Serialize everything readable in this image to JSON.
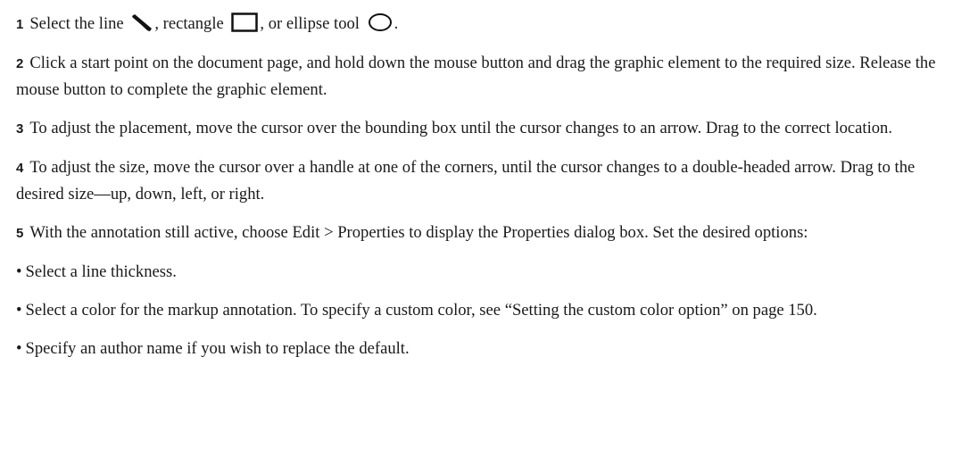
{
  "steps": [
    {
      "number": "1",
      "parts": {
        "a": "Select the line",
        "b": ", rectangle",
        "c": ", or ellipse tool",
        "d": "."
      },
      "icons": [
        "line-tool-icon",
        "rectangle-tool-icon",
        "ellipse-tool-icon"
      ]
    },
    {
      "number": "2",
      "text": "Click a start point on the document page, and hold down the mouse button and drag the graphic element to the required size. Release the mouse button to complete the graphic element."
    },
    {
      "number": "3",
      "text": "To adjust the placement, move the cursor over the bounding box until the cursor changes to an arrow. Drag to the correct location."
    },
    {
      "number": "4",
      "text": "To adjust the size, move the cursor over a handle at one of the corners, until the cursor changes to a double-headed arrow. Drag to the desired size—up, down, left, or right."
    },
    {
      "number": "5",
      "text": "With the annotation still active, choose Edit > Properties to display the Properties dialog box. Set the desired options:"
    }
  ],
  "bullets": [
    {
      "marker": "•",
      "text": "Select a line thickness."
    },
    {
      "marker": "•",
      "text": "Select a color for the markup annotation. To specify a custom color, see “Setting the custom color option” on page 150."
    },
    {
      "marker": "•",
      "text": "Specify an author name if you wish to replace the default."
    }
  ]
}
